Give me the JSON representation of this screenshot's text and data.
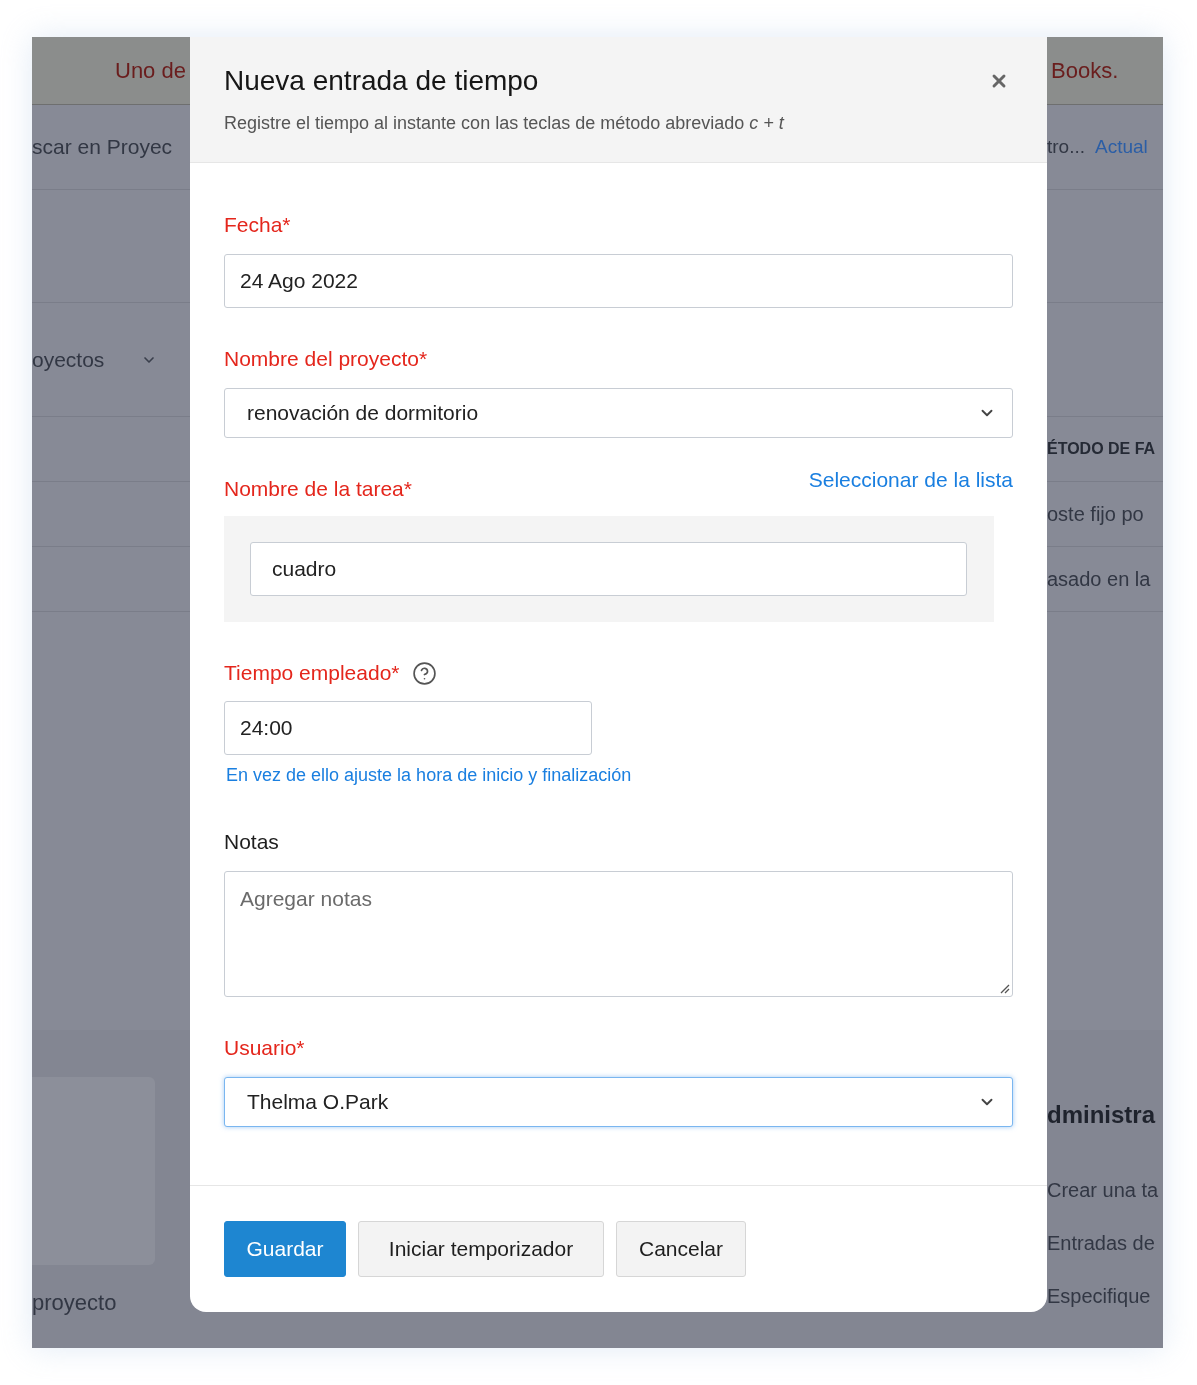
{
  "background_app": {
    "top_bar": {
      "left_text": "Uno de",
      "right_text": "Books."
    },
    "search_row": {
      "search_text": "scar en Proyec",
      "filter_text": "tro...",
      "link": "Actual"
    },
    "sidebar_dropdown": {
      "label": "oyectos"
    },
    "table": {
      "header": "ÉTODO DE FA",
      "rows": [
        "oste fijo po",
        "asado en la"
      ]
    },
    "bottom_left": {
      "caption": "proyecto"
    },
    "admin_panel": {
      "title": "dministra",
      "items": [
        "Crear una ta",
        "Entradas de",
        "Especifique"
      ]
    }
  },
  "dialog": {
    "title": "Nueva entrada de tiempo",
    "subtitle": "Registre el tiempo al instante con las teclas de método abreviado *c + t*",
    "fields": [
      {
        "kind": "date",
        "label": "Fecha*",
        "required": true,
        "value": "24 Ago 2022"
      },
      {
        "kind": "select",
        "label": "Nombre del proyecto*",
        "required": true,
        "value": "renovación de dormitorio",
        "focused": false
      },
      {
        "kind": "task",
        "label": "Nombre de la tarea*",
        "required": true,
        "link": "Seleccionar de la lista",
        "value": "cuadro"
      },
      {
        "kind": "time",
        "label": "Tiempo empleado*",
        "required": true,
        "value": "24:00",
        "link": "En vez de ello ajuste la hora de inicio y finalización"
      },
      {
        "kind": "textarea",
        "label": "Notas",
        "required": false,
        "placeholder": "Agregar notas"
      },
      {
        "kind": "select",
        "label": "Usuario*",
        "required": true,
        "value": "Thelma O.Park",
        "focused": true
      }
    ],
    "buttons": [
      {
        "kind": "save",
        "label": "Guardar"
      },
      {
        "kind": "timer",
        "label": "Iniciar temporizador"
      },
      {
        "kind": "cancel",
        "label": "Cancelar"
      }
    ]
  }
}
